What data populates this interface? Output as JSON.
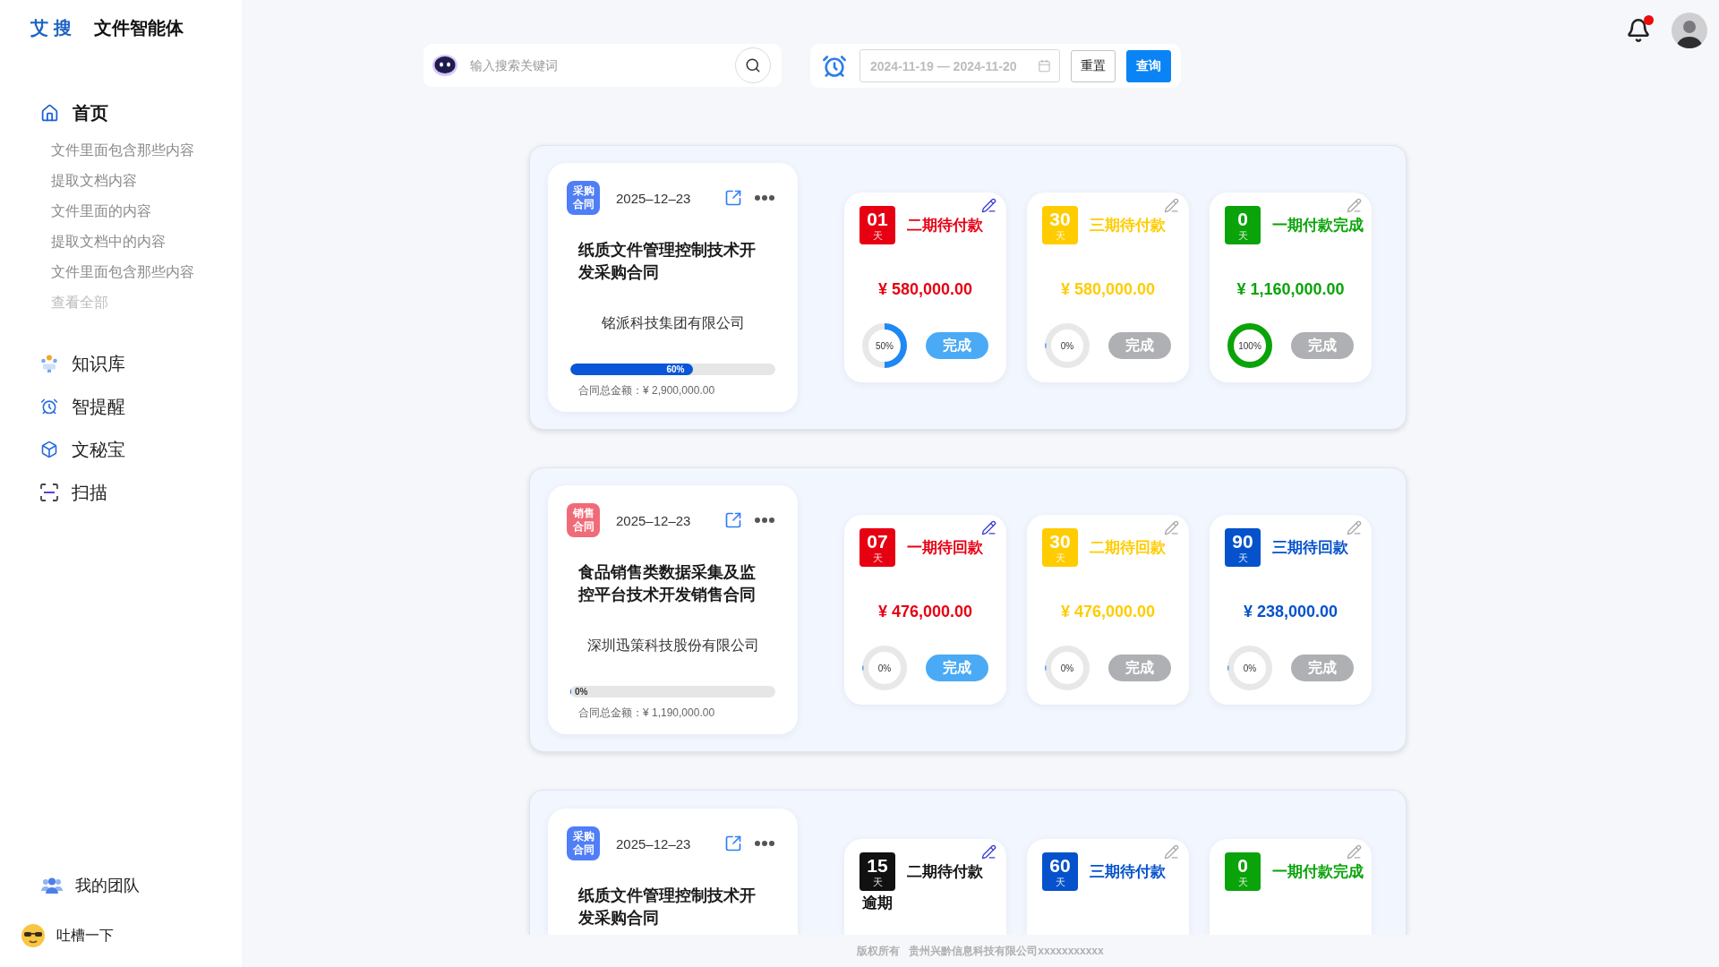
{
  "app": {
    "logo": "艾 搜",
    "title": "文件智能体"
  },
  "sidebar": {
    "nav": [
      {
        "label": "首页",
        "selected": true,
        "children": [
          {
            "label": "文件里面包含那些内容"
          },
          {
            "label": "提取文档内容"
          },
          {
            "label": "文件里面的内容"
          },
          {
            "label": "提取文档中的内容"
          },
          {
            "label": "文件里面包含那些内容"
          }
        ],
        "more": "查看全部"
      },
      {
        "label": "知识库",
        "selected": false
      },
      {
        "label": "智提醒",
        "selected": false
      },
      {
        "label": "文秘宝",
        "selected": false
      },
      {
        "label": "扫描",
        "selected": false
      }
    ],
    "bottom": [
      {
        "label": "我的团队"
      },
      {
        "label": "吐槽一下"
      }
    ]
  },
  "toolbar": {
    "search": {
      "placeholder": "输入搜索关键词"
    },
    "date_range": {
      "placeholder": "2024-11-19 — 2024-11-20"
    },
    "buttons": [
      {
        "label": "重置",
        "kind": "default"
      },
      {
        "label": "查询",
        "kind": "primary"
      }
    ]
  },
  "header": {
    "notifications": {
      "unread": true
    }
  },
  "contracts": [
    {
      "tag": {
        "label": "采购合同",
        "color": "#4f7ef6"
      },
      "date": "2025–12–23",
      "title": "纸质文件管理控制技术开发采购合同",
      "company": "铭派科技集团有限公司",
      "progress": {
        "level": 0.6,
        "label": "60%"
      },
      "total": "合同总金额：¥ 2,900,000.00",
      "installments": [
        {
          "days": "01",
          "unit": "天",
          "title": "二期待付款",
          "color": "#e60012",
          "edit_active": true,
          "amount": "¥ 580,000.00",
          "progress": {
            "level": 0.5,
            "label": "50%"
          },
          "button": {
            "label": "完成",
            "disabled": false
          }
        },
        {
          "days": "30",
          "unit": "天",
          "title": "三期待付款",
          "color": "#ffcc00",
          "edit_active": false,
          "amount": "¥ 580,000.00",
          "progress": {
            "level": 0,
            "label": "0%"
          },
          "button": {
            "label": "完成",
            "disabled": true
          }
        },
        {
          "days": "0",
          "unit": "天",
          "title": "一期付款完成",
          "color": "#0aa30a",
          "edit_active": false,
          "amount": "¥ 1,160,000.00",
          "progress": {
            "level": 1,
            "label": "100%"
          },
          "button": {
            "label": "完成",
            "disabled": true
          }
        }
      ]
    },
    {
      "tag": {
        "label": "销售合同",
        "color": "#f06b78"
      },
      "date": "2025–12–23",
      "title": "食品销售类数据采集及监控平台技术开发销售合同",
      "company": "深圳迅策科技股份有限公司",
      "progress": {
        "level": 0,
        "label": "0%"
      },
      "total": "合同总金额：¥ 1,190,000.00",
      "installments": [
        {
          "days": "07",
          "unit": "天",
          "title": "一期待回款",
          "color": "#e60012",
          "edit_active": true,
          "amount": "¥ 476,000.00",
          "progress": {
            "level": 0,
            "label": "0%"
          },
          "button": {
            "label": "完成",
            "disabled": false
          }
        },
        {
          "days": "30",
          "unit": "天",
          "title": "二期待回款",
          "color": "#ffcc00",
          "edit_active": false,
          "amount": "¥ 476,000.00",
          "progress": {
            "level": 0,
            "label": "0%"
          },
          "button": {
            "label": "完成",
            "disabled": true
          }
        },
        {
          "days": "90",
          "unit": "天",
          "title": "三期待回款",
          "color": "#0552cc",
          "edit_active": false,
          "amount": "¥ 238,000.00",
          "progress": {
            "level": 0,
            "label": "0%"
          },
          "button": {
            "label": "完成",
            "disabled": true
          }
        }
      ]
    },
    {
      "tag": {
        "label": "采购合同",
        "color": "#4f7ef6"
      },
      "date": "2025–12–23",
      "title": "纸质文件管理控制技术开发采购合同",
      "installments": [
        {
          "days": "15",
          "unit": "天",
          "title": "二期待付款",
          "color": "#111111",
          "edit_active": true,
          "note": "逾期"
        },
        {
          "days": "60",
          "unit": "天",
          "title": "三期待付款",
          "color": "#0552cc",
          "edit_active": false
        },
        {
          "days": "0",
          "unit": "天",
          "title": "一期付款完成",
          "color": "#0aa30a",
          "edit_active": false
        }
      ]
    }
  ],
  "footer": "版权所有   贵州兴黔信息科技有限公司xxxxxxxxxxx"
}
